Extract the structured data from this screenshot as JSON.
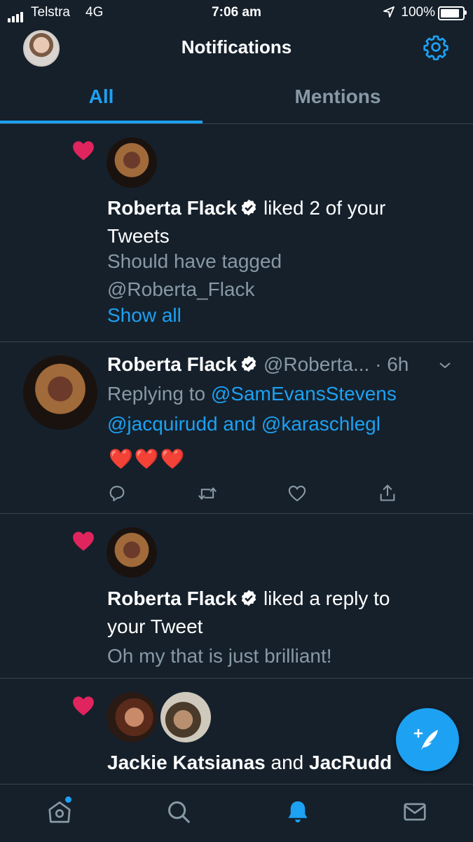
{
  "status_bar": {
    "carrier": "Telstra",
    "network": "4G",
    "time": "7:06 am",
    "battery": "100%",
    "battery_level": 1.0
  },
  "header": {
    "title": "Notifications"
  },
  "tabs": [
    {
      "label": "All",
      "selected": true
    },
    {
      "label": "Mentions",
      "selected": false
    }
  ],
  "notifications": [
    {
      "type": "like",
      "name": "Roberta Flack",
      "action_line1": "liked 2 of your",
      "action_line2": "Tweets",
      "preview_line1": "Should have tagged",
      "preview_line2": "@Roberta_Flack",
      "show_all": "Show all"
    },
    {
      "type": "tweet",
      "name": "Roberta Flack",
      "handle": "@Roberta...",
      "time": "· 6h",
      "replying_prefix": "Replying to",
      "replying_1": "@SamEvansStevens",
      "replying_2": "@jacquirudd",
      "replying_and": "and",
      "replying_3": "@karaschlegl",
      "body": "❤️❤️❤️"
    },
    {
      "type": "like",
      "name": "Roberta Flack",
      "action_line1": "liked a reply to",
      "action_line2": "your Tweet",
      "preview_line1": "Oh my that is just brilliant!"
    },
    {
      "type": "like",
      "name1": "Jackie Katsianas",
      "and": "and",
      "name2": "JacRudd"
    }
  ],
  "colors": {
    "background": "#15202b",
    "accent": "#1da1f2",
    "like": "#e0245e",
    "secondary_text": "#8899a6",
    "divider": "#38444d"
  },
  "icons": [
    "settings-gear-icon",
    "heart-icon",
    "verified-badge-icon",
    "reply-icon",
    "retweet-icon",
    "like-icon",
    "share-icon",
    "home-icon",
    "search-icon",
    "notifications-bell-icon",
    "messages-envelope-icon",
    "compose-tweet-icon"
  ]
}
